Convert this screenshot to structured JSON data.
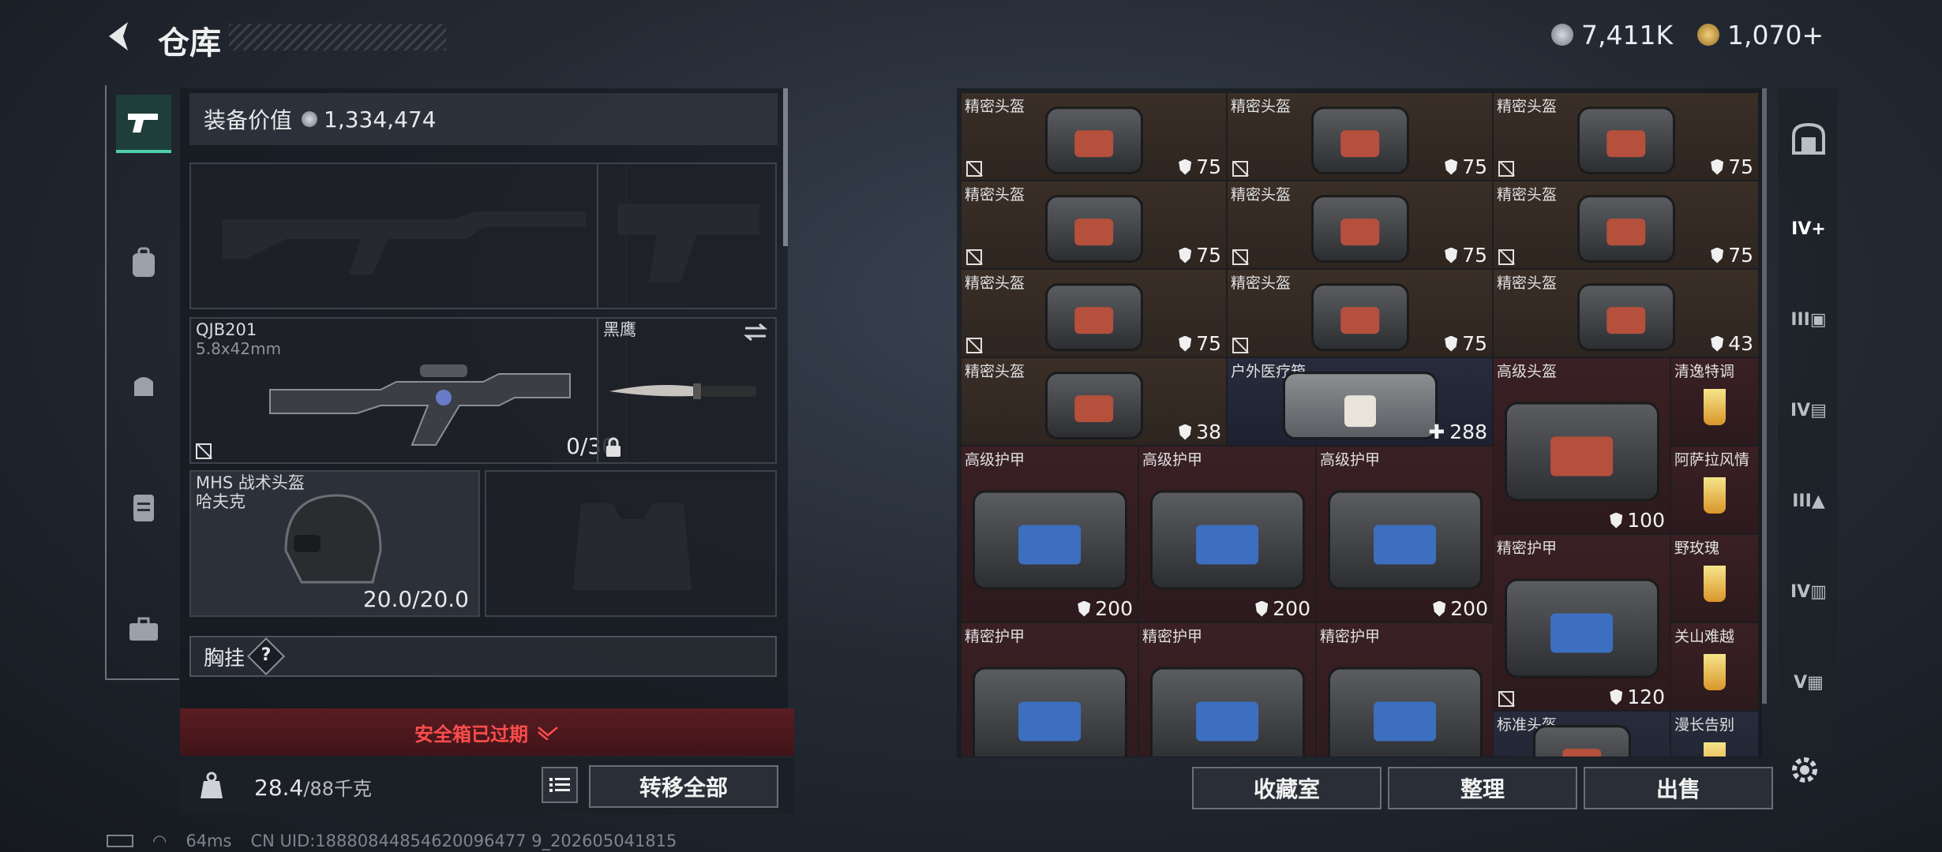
{
  "header": {
    "title": "仓库",
    "currencies": [
      {
        "value": "7,411K",
        "color": "#9aa3ad"
      },
      {
        "value": "1,070+",
        "color": "#d4a64a"
      }
    ]
  },
  "left_sidebar": {
    "items": [
      "pistol-icon",
      "backpack-icon",
      "bag-icon",
      "rig-icon",
      "toolbox-icon"
    ]
  },
  "equipment": {
    "value_label": "装备价值",
    "value": "1,334,474",
    "primary": {
      "name": "QJB201",
      "ammo_type": "5.8x42mm",
      "ammo": "0/30"
    },
    "melee": {
      "name": "黑鹰"
    },
    "helmet": {
      "name": "MHS 战术头盔",
      "sub": "哈夫克",
      "durability": "20.0/20.0"
    },
    "chest_rig_label": "胸挂",
    "help": "?"
  },
  "safe_box": {
    "status": "安全箱已过期"
  },
  "weight": {
    "current": "28.4",
    "max": "/88千克"
  },
  "buttons": {
    "transfer_all": "转移全部",
    "collection": "收藏室",
    "organize": "整理",
    "sell": "出售"
  },
  "inventory": [
    {
      "name": "精密头盔",
      "dur": "75",
      "type": "helmet",
      "bg": "brown",
      "nolock": true
    },
    {
      "name": "精密头盔",
      "dur": "75",
      "type": "helmet",
      "bg": "brown",
      "nolock": true
    },
    {
      "name": "精密头盔",
      "dur": "75",
      "type": "helmet",
      "bg": "brown",
      "nolock": true
    },
    {
      "name": "精密头盔",
      "dur": "75",
      "type": "helmet",
      "bg": "brown",
      "nolock": true
    },
    {
      "name": "精密头盔",
      "dur": "75",
      "type": "helmet",
      "bg": "brown",
      "nolock": true
    },
    {
      "name": "精密头盔",
      "dur": "75",
      "type": "helmet",
      "bg": "brown",
      "nolock": true
    },
    {
      "name": "精密头盔",
      "dur": "75",
      "type": "helmet",
      "bg": "brown",
      "nolock": true
    },
    {
      "name": "精密头盔",
      "dur": "75",
      "type": "helmet",
      "bg": "brown",
      "nolock": true
    },
    {
      "name": "精密头盔",
      "dur": "43",
      "type": "helmet",
      "bg": "brown",
      "nolock": false
    },
    {
      "name": "精密头盔",
      "dur": "38",
      "type": "helmet",
      "bg": "brown",
      "nolock": false
    },
    {
      "name": "户外医疗箱",
      "dur": "288",
      "type": "med",
      "bg": "blue",
      "nolock": false
    },
    {
      "name": "高级头盔",
      "dur": "100",
      "type": "helmet-big",
      "bg": "red",
      "nolock": false
    },
    {
      "name": "清逸特调",
      "dur": "",
      "type": "drink",
      "bg": "red",
      "nolock": false
    },
    {
      "name": "高级护甲",
      "dur": "200",
      "type": "armor-big",
      "bg": "red",
      "nolock": false
    },
    {
      "name": "高级护甲",
      "dur": "200",
      "type": "armor-big",
      "bg": "red",
      "nolock": false
    },
    {
      "name": "高级护甲",
      "dur": "200",
      "type": "armor-big",
      "bg": "red",
      "nolock": false
    },
    {
      "name": "阿萨拉风情",
      "dur": "",
      "type": "drink",
      "bg": "red",
      "nolock": false
    },
    {
      "name": "精密护甲",
      "dur": "120",
      "type": "armor-big",
      "bg": "red",
      "nolock": true
    },
    {
      "name": "野玫瑰",
      "dur": "",
      "type": "drink",
      "bg": "red",
      "nolock": false
    },
    {
      "name": "精密护甲",
      "dur": "",
      "type": "armor-big",
      "bg": "red",
      "nolock": false
    },
    {
      "name": "精密护甲",
      "dur": "",
      "type": "armor-big",
      "bg": "red",
      "nolock": false
    },
    {
      "name": "精密护甲",
      "dur": "",
      "type": "armor-big",
      "bg": "red",
      "nolock": false
    },
    {
      "name": "关山难越",
      "dur": "",
      "type": "drink",
      "bg": "red",
      "nolock": false
    },
    {
      "name": "标准头盔",
      "dur": "",
      "type": "helmet",
      "bg": "blue",
      "nolock": false
    },
    {
      "name": "漫长告别",
      "dur": "",
      "type": "drink",
      "bg": "blue",
      "nolock": false
    }
  ],
  "right_sidebar": {
    "labels": [
      "IV",
      "III",
      "IV",
      "III",
      "IV",
      "V"
    ]
  },
  "status": {
    "ping": "64ms",
    "uid": "CN UID:18880844854620096477 9_202605041815"
  }
}
